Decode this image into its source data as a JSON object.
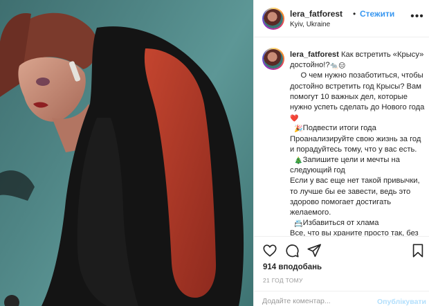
{
  "post": {
    "username": "lera_fatforest",
    "follow_label": "Стежити",
    "separator": "•",
    "location": "Kyiv, Ukraine",
    "more_icon": "more-horizontal-icon"
  },
  "caption": {
    "username": "lera_fatforest",
    "intro": "Как встретить «Крысу» достойно!?",
    "intro_emoji": "🐀😑",
    "p1": "     О чем нужно позаботиться, чтобы достойно встретить год Крысы? Вам помогут 10 важных дел, которые нужно успеть сделать до Нового года",
    "p1_emoji": "❤️",
    "item1_emoji": "🎉",
    "item1_title": "Подвести итоги года",
    "item1_text": "Проанализируйте свою жизнь за год и порадуйтесь тому, что у вас есть.",
    "item2_emoji": "🎄",
    "item2_title": "Запишите цели и мечты на следующий год",
    "item2_text": "Если у вас еще нет такой привычки, то лучше бы ее завести, ведь это здорово помогает достигать желаемого.",
    "item3_emoji": "📇",
    "item3_title": "Избавиться от хлама",
    "item3_text": "Все, что вы храните просто так, без надобности, \"на всякий случай\", не только загрязняет вашу квартиру, но"
  },
  "actions": {
    "like_icon": "heart-icon",
    "comment_icon": "comment-icon",
    "share_icon": "share-icon",
    "save_icon": "bookmark-icon"
  },
  "likes_text": "914 вподобань",
  "time_text": "21 ГОД ТОМУ",
  "comment": {
    "placeholder": "Додайте коментар...",
    "publish_label": "Опублікувати"
  },
  "colors": {
    "link": "#3897f0",
    "publish_disabled": "#b2dffc",
    "muted": "#999999",
    "text": "#262626"
  }
}
